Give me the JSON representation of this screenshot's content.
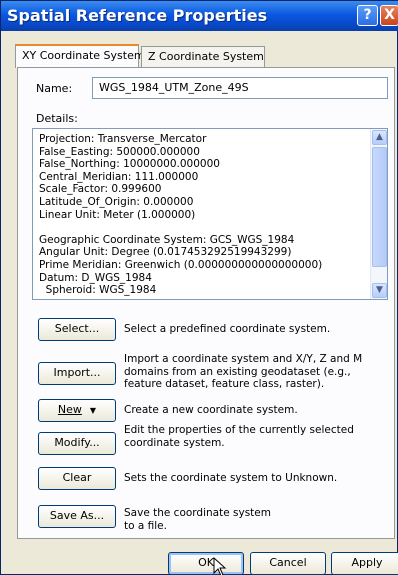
{
  "window": {
    "title": "Spatial Reference Properties",
    "help_label": "?",
    "close_label": "X"
  },
  "tabs": [
    {
      "label": "XY Coordinate System",
      "active": true
    },
    {
      "label": "Z Coordinate System",
      "active": false
    }
  ],
  "name": {
    "label": "Name:",
    "value": "WGS_1984_UTM_Zone_49S"
  },
  "details": {
    "label": "Details:",
    "lines": [
      "Projection: Transverse_Mercator",
      "False_Easting: 500000.000000",
      "False_Northing: 10000000.000000",
      "Central_Meridian: 111.000000",
      "Scale_Factor: 0.999600",
      "Latitude_Of_Origin: 0.000000",
      "Linear Unit: Meter (1.000000)",
      "",
      "Geographic Coordinate System: GCS_WGS_1984",
      "Angular Unit: Degree (0.017453292519943299)",
      "Prime Meridian: Greenwich (0.000000000000000000)",
      "Datum: D_WGS_1984",
      "  Spheroid: WGS_1984"
    ]
  },
  "actions": [
    {
      "label": "Select...",
      "description": "Select a predefined coordinate system."
    },
    {
      "label": "Import...",
      "description": "Import a coordinate system and X/Y, Z and M domains from an existing geodataset (e.g., feature dataset, feature class, raster)."
    },
    {
      "label": "New",
      "description": "Create a new coordinate system."
    },
    {
      "label": "Modify...",
      "description": "Edit the properties of the currently selected coordinate system."
    },
    {
      "label": "Clear",
      "description": "Sets the coordinate system to Unknown."
    },
    {
      "label": "Save As...",
      "description": "Save the coordinate system to a file."
    }
  ],
  "footer": {
    "ok": "OK",
    "cancel": "Cancel",
    "apply": "Apply"
  }
}
